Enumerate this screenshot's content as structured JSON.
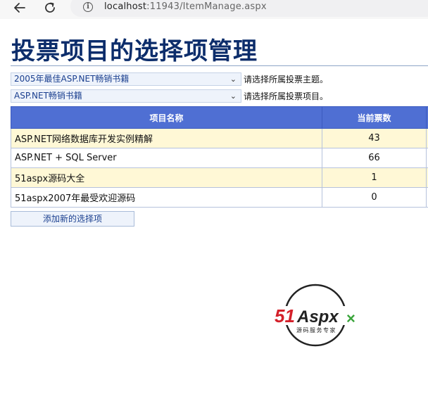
{
  "browser": {
    "back_icon": "arrow-left-icon",
    "reload_icon": "reload-icon",
    "info_icon": "info-icon",
    "url_host": "localhost",
    "url_rest": ":11943/ItemManage.aspx"
  },
  "page": {
    "title": "投票项目的选择项管理"
  },
  "topic_select": {
    "value": "2005年最佳ASP.NET畅销书籍",
    "hint": "请选择所属投票主题。"
  },
  "item_select": {
    "value": "ASP.NET畅销书籍",
    "hint": "请选择所属投票项目。"
  },
  "grid": {
    "headers": [
      "项目名称",
      "当前票数"
    ],
    "rows": [
      {
        "name": "ASP.NET网络数据库开发实例精解",
        "votes": "43"
      },
      {
        "name": "ASP.NET + SQL Server",
        "votes": "66"
      },
      {
        "name": "51aspx源码大全",
        "votes": "1"
      },
      {
        "name": "51aspx2007年最受欢迎源码",
        "votes": "0"
      }
    ]
  },
  "actions": {
    "add_label": "添加新的选择项"
  },
  "logo": {
    "brand": "51Aspx",
    "tagline": "源码服务专家"
  },
  "colors": {
    "title": "#0c2d6b",
    "header_bg": "#4f6fd3",
    "alt_row": "#fff8d6",
    "logo_red": "#d4202a",
    "logo_green": "#39a43a"
  }
}
